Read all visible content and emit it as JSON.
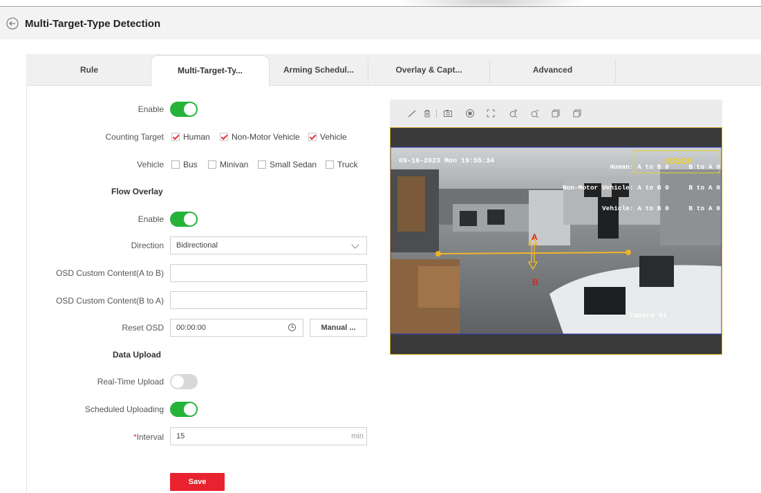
{
  "header": {
    "title": "Multi-Target-Type Detection"
  },
  "tabs": [
    {
      "label": "Rule"
    },
    {
      "label": "Multi-Target-Ty...",
      "active": true
    },
    {
      "label": "Arming Schedul..."
    },
    {
      "label": "Overlay & Capt..."
    },
    {
      "label": "Advanced"
    }
  ],
  "form": {
    "enable_label": "Enable",
    "enable_on": true,
    "counting_target_label": "Counting Target",
    "counting_targets": [
      {
        "label": "Human",
        "checked": true
      },
      {
        "label": "Non-Motor Vehicle",
        "checked": true
      },
      {
        "label": "Vehicle",
        "checked": true
      }
    ],
    "vehicle_label": "Vehicle",
    "vehicle_types": [
      {
        "label": "Bus",
        "checked": false
      },
      {
        "label": "Minivan",
        "checked": false
      },
      {
        "label": "Small Sedan",
        "checked": false
      },
      {
        "label": "Truck",
        "checked": false
      }
    ],
    "flow_overlay": {
      "section_title": "Flow Overlay",
      "enable_label": "Enable",
      "enable_on": true,
      "direction_label": "Direction",
      "direction_value": "Bidirectional",
      "osd_a_to_b_label": "OSD Custom Content(A to B)",
      "osd_a_to_b_value": "",
      "osd_b_to_a_label": "OSD Custom Content(B to A)",
      "osd_b_to_a_value": "",
      "reset_osd_label": "Reset OSD",
      "reset_osd_value": "00:00:00",
      "manual_button": "Manual ..."
    },
    "data_upload": {
      "section_title": "Data Upload",
      "realtime_label": "Real-Time Upload",
      "realtime_on": false,
      "scheduled_label": "Scheduled Uploading",
      "scheduled_on": true,
      "interval_required_mark": "*",
      "interval_label": "Interval",
      "interval_value": "15",
      "interval_unit": "min"
    },
    "save_button": "Save"
  },
  "video": {
    "timestamp": "09-18-2023 Mon 19:55:34",
    "osd_lines": [
      "Human: A to B 0     B to A 0",
      "Non-Motor Vehicle: A to B 0     B to A 0",
      "Vehicle: A to B 0     B to A 0"
    ],
    "osd_tag": "#OSD#",
    "camera_name": "Camera 01",
    "line_label_a": "A",
    "line_label_b": "B",
    "toolbar_icons": [
      "draw-line-icon",
      "delete-icon",
      "capture-icon",
      "record-icon",
      "fullscreen-icon",
      "zoom-in-icon",
      "zoom-out-icon",
      "window-icon",
      "window-restore-icon"
    ]
  },
  "colors": {
    "accent_red": "#e8232f",
    "toggle_green": "#25b33a",
    "video_border": "#d4a92a",
    "detection_line": "#f0b429"
  }
}
